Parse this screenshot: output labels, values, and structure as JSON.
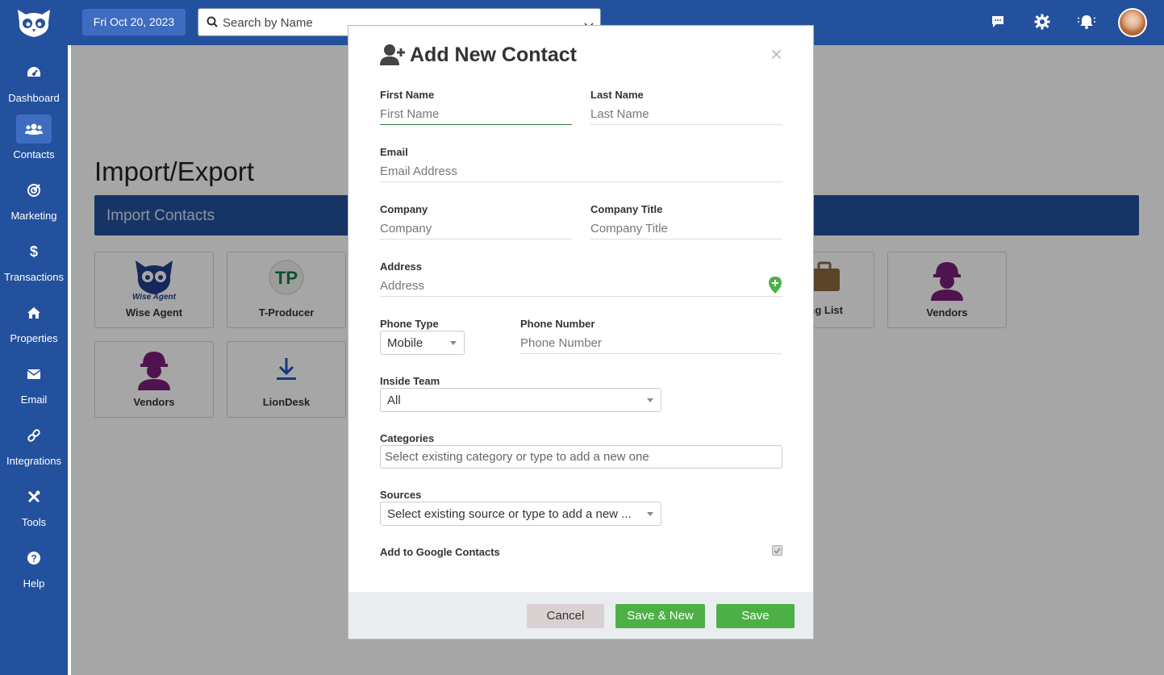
{
  "topbar": {
    "date": "Fri Oct 20, 2023",
    "search_placeholder": "Search by Name"
  },
  "sidebar": {
    "items": [
      {
        "label": "Dashboard",
        "icon": "dashboard-icon"
      },
      {
        "label": "Contacts",
        "icon": "contacts-icon",
        "active": true
      },
      {
        "label": "Marketing",
        "icon": "marketing-icon"
      },
      {
        "label": "Transactions",
        "icon": "dollar-icon"
      },
      {
        "label": "Properties",
        "icon": "home-icon"
      },
      {
        "label": "Email",
        "icon": "envelope-icon"
      },
      {
        "label": "Integrations",
        "icon": "link-icon"
      },
      {
        "label": "Tools",
        "icon": "tools-icon"
      },
      {
        "label": "Help",
        "icon": "question-icon"
      }
    ]
  },
  "page": {
    "title": "Import/Export",
    "section": "Import Contacts",
    "cards": [
      {
        "label": "Wise Agent",
        "icon": "wise-agent-logo"
      },
      {
        "label": "T-Producer",
        "icon": "t-producer-logo"
      },
      {
        "label": "ng List",
        "icon": "briefcase-icon"
      },
      {
        "label": "Vendors",
        "icon": "worker-icon"
      },
      {
        "label": "Vendors",
        "icon": "worker-icon"
      },
      {
        "label": "LionDesk",
        "icon": "download-icon"
      }
    ],
    "wise_agent_logo_text": "Wise Agent"
  },
  "modal": {
    "title": "Add New Contact",
    "close": "×",
    "first_name_label": "First Name",
    "first_name_placeholder": "First Name",
    "last_name_label": "Last Name",
    "last_name_placeholder": "Last Name",
    "email_label": "Email",
    "email_placeholder": "Email Address",
    "company_label": "Company",
    "company_placeholder": "Company",
    "company_title_label": "Company Title",
    "company_title_placeholder": "Company Title",
    "address_label": "Address",
    "address_placeholder": "Address",
    "phone_type_label": "Phone Type",
    "phone_type_value": "Mobile",
    "phone_number_label": "Phone Number",
    "phone_number_placeholder": "Phone Number",
    "inside_team_label": "Inside Team",
    "inside_team_value": "All",
    "categories_label": "Categories",
    "categories_placeholder": "Select existing category or type to add a new one",
    "sources_label": "Sources",
    "sources_placeholder": "Select existing source or type to add a new ...",
    "google_label": "Add to Google Contacts",
    "google_checked": true,
    "cancel_label": "Cancel",
    "save_new_label": "Save & New",
    "save_label": "Save"
  },
  "colors": {
    "primary": "#24519e",
    "accent": "#3e6cc0",
    "success": "#4db046",
    "vendor_purple": "#7a1f7a"
  }
}
